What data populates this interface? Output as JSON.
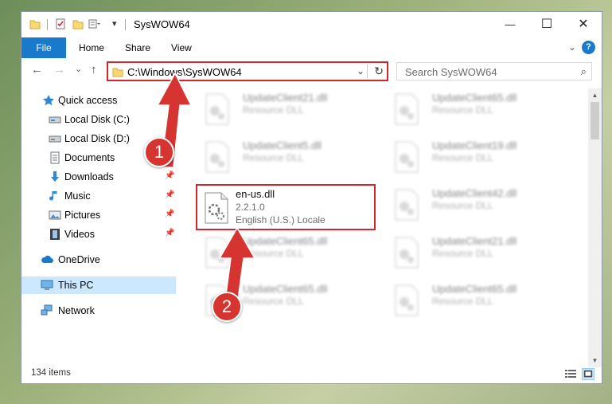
{
  "window": {
    "title": "SysWOW64",
    "controls": {
      "minimize": "—",
      "maximize": "☐",
      "close": "✕"
    }
  },
  "ribbon": {
    "file_tab": "File",
    "tabs": [
      "Home",
      "Share",
      "View"
    ],
    "expand": "⌄",
    "help": "?"
  },
  "nav": {
    "back": "←",
    "forward": "→",
    "recent": "⌄",
    "up": "↑",
    "address": "C:\\Windows\\SysWOW64",
    "address_dropdown": "⌄",
    "refresh": "↻",
    "search_placeholder": "Search SysWOW64",
    "search_icon": "⌕"
  },
  "sidebar": {
    "items": [
      {
        "label": "Quick access",
        "icon": "star-icon",
        "pinned": false
      },
      {
        "label": "Local Disk (C:)",
        "icon": "drive-icon",
        "pinned": true
      },
      {
        "label": "Local Disk (D:)",
        "icon": "drive-icon",
        "pinned": true
      },
      {
        "label": "Documents",
        "icon": "documents-icon",
        "pinned": true
      },
      {
        "label": "Downloads",
        "icon": "download-icon",
        "pinned": true
      },
      {
        "label": "Music",
        "icon": "music-icon",
        "pinned": true
      },
      {
        "label": "Pictures",
        "icon": "pictures-icon",
        "pinned": true
      },
      {
        "label": "Videos",
        "icon": "videos-icon",
        "pinned": true
      },
      {
        "label": "OneDrive",
        "icon": "cloud-icon",
        "pinned": false
      },
      {
        "label": "This PC",
        "icon": "computer-icon",
        "pinned": false,
        "selected": true
      },
      {
        "label": "Network",
        "icon": "network-icon",
        "pinned": false
      }
    ],
    "pin_glyph": "📌"
  },
  "files": {
    "left_column": [
      {
        "name": "UpdateClient21.dll",
        "desc": "Resource DLL"
      },
      {
        "name": "UpdateClient5.dll",
        "desc": "Resource DLL"
      },
      {
        "name": "UpdateClient65.dll",
        "desc": "Resource DLL"
      },
      {
        "name": "UpdateClient65.dll",
        "desc": "Resource DLL"
      }
    ],
    "right_column": [
      {
        "name": "UpdateClient65.dll",
        "desc": "Resource DLL"
      },
      {
        "name": "UpdateClient19.dll",
        "desc": "Resource DLL"
      },
      {
        "name": "UpdateClient42.dll",
        "desc": "Resource DLL"
      },
      {
        "name": "UpdateClient21.dll",
        "desc": "Resource DLL"
      },
      {
        "name": "UpdateClient65.dll",
        "desc": "Resource DLL"
      }
    ],
    "highlighted": {
      "name": "en-us.dll",
      "version": "2.2.1.0",
      "desc": "English (U.S.) Locale"
    }
  },
  "status": {
    "item_count": "134 items"
  },
  "annotations": {
    "step1": "1",
    "step2": "2"
  },
  "colors": {
    "accent": "#1979ca",
    "highlight": "#d2262c",
    "selected": "#cce8ff"
  }
}
